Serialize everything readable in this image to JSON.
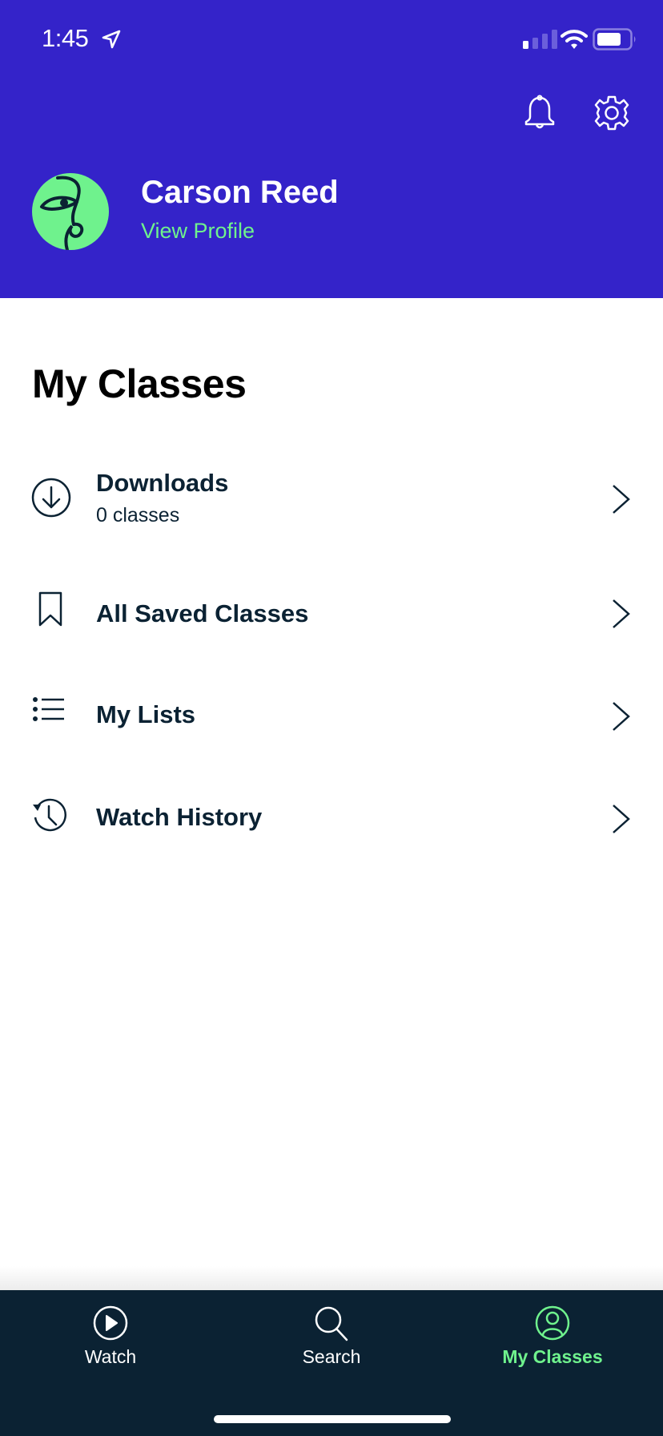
{
  "status_bar": {
    "time": "1:45",
    "location_icon": "location-arrow-icon",
    "signal_icon": "cellular-signal-icon",
    "wifi_icon": "wifi-icon",
    "battery_icon": "battery-icon"
  },
  "header": {
    "notifications_icon": "bell-icon",
    "settings_icon": "gear-icon",
    "profile": {
      "name": "Carson Reed",
      "view_profile_label": "View Profile",
      "avatar_icon": "face-line-art-avatar"
    }
  },
  "main": {
    "title": "My Classes",
    "items": [
      {
        "label": "Downloads",
        "subtitle": "0 classes",
        "icon": "download-circle-icon"
      },
      {
        "label": "All Saved Classes",
        "icon": "bookmark-icon"
      },
      {
        "label": "My Lists",
        "icon": "list-icon"
      },
      {
        "label": "Watch History",
        "icon": "history-clock-icon"
      }
    ]
  },
  "tabbar": {
    "tabs": [
      {
        "label": "Watch",
        "icon": "play-circle-icon",
        "active": false
      },
      {
        "label": "Search",
        "icon": "search-icon",
        "active": false
      },
      {
        "label": "My Classes",
        "icon": "user-circle-icon",
        "active": true
      }
    ]
  },
  "colors": {
    "header_bg": "#3423c9",
    "accent_green": "#6ff28d",
    "text_dark": "#0b2233",
    "tabbar_bg": "#0b2233"
  }
}
